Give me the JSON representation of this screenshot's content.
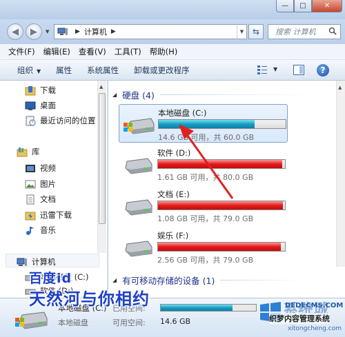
{
  "window": {
    "minimize": "—",
    "maximize": "□",
    "close": "✕"
  },
  "address": {
    "path": "计算机",
    "search_placeholder": "搜索 计算机"
  },
  "menu": [
    "文件(F)",
    "编辑(E)",
    "查看(V)",
    "工具(T)",
    "帮助(H)"
  ],
  "commands": {
    "organize": "组织",
    "properties": "属性",
    "system_properties": "系统属性",
    "uninstall": "卸载或更改程序"
  },
  "nav": {
    "downloads": "下载",
    "desktop": "桌面",
    "recent": "最近访问的位置",
    "library": "库",
    "videos": "视频",
    "pictures": "图片",
    "documents": "文档",
    "thunder": "迅雷下载",
    "music": "音乐",
    "computer": "计算机",
    "local_c": "本地磁盘 (C:)",
    "software_d": "软件 (D:)"
  },
  "groups": {
    "hard_disks": "硬盘 (4)",
    "removable": "有可移动存储的设备 (1)"
  },
  "drives": [
    {
      "name": "本地磁盘 (C:)",
      "info": "14.6 GB 可用，共 60.0 GB",
      "used_fraction": 0.757,
      "color": "#1a9ec3"
    },
    {
      "name": "软件 (D:)",
      "info": "1.61 GB 可用，共 80.0 GB",
      "used_fraction": 0.98,
      "color": "#e51a1a"
    },
    {
      "name": "文档 (E:)",
      "info": "1.08 GB 可用，共 79.0 GB",
      "used_fraction": 0.986,
      "color": "#e51a1a"
    },
    {
      "name": "娱乐 (F:)",
      "info": "2.56 GB 可用，共 79.0 GB",
      "used_fraction": 0.968,
      "color": "#e51a1a"
    }
  ],
  "details": {
    "name": "本地磁盘 (C:)",
    "type": "本地磁盘",
    "used_label": "已用空间:",
    "free_label": "可用空间:",
    "free_value": "14.6 GB",
    "used_fraction": 0.757
  },
  "overlay": {
    "line1": "百度id",
    "line2": "天然河与你相约"
  },
  "watermark": {
    "brand": "系统城",
    "domain": "DEDECMS.COM",
    "name": "织梦内容管理系统",
    "url": "xitongcheng.com"
  }
}
